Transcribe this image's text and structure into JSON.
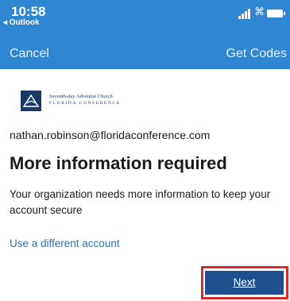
{
  "status_bar": {
    "time": "10:58",
    "back_app": "◂ Outlook"
  },
  "nav": {
    "cancel_label": "Cancel",
    "get_codes_label": "Get Codes"
  },
  "logo": {
    "line1": "Seventh-day Adventist Church",
    "line2": "FLORIDA CONFERENCE"
  },
  "account": {
    "email": "nathan.robinson@floridaconference.com"
  },
  "content": {
    "title": "More information required",
    "description": "Your organization needs more information to keep your account secure",
    "use_different_account_label": "Use a different account"
  },
  "actions": {
    "next_label": "Next"
  },
  "colors": {
    "header_blue": "#2f86d1",
    "button_blue": "#1f4f8f",
    "highlight_red": "#d32f2f",
    "link_blue": "#2f6fa7"
  }
}
